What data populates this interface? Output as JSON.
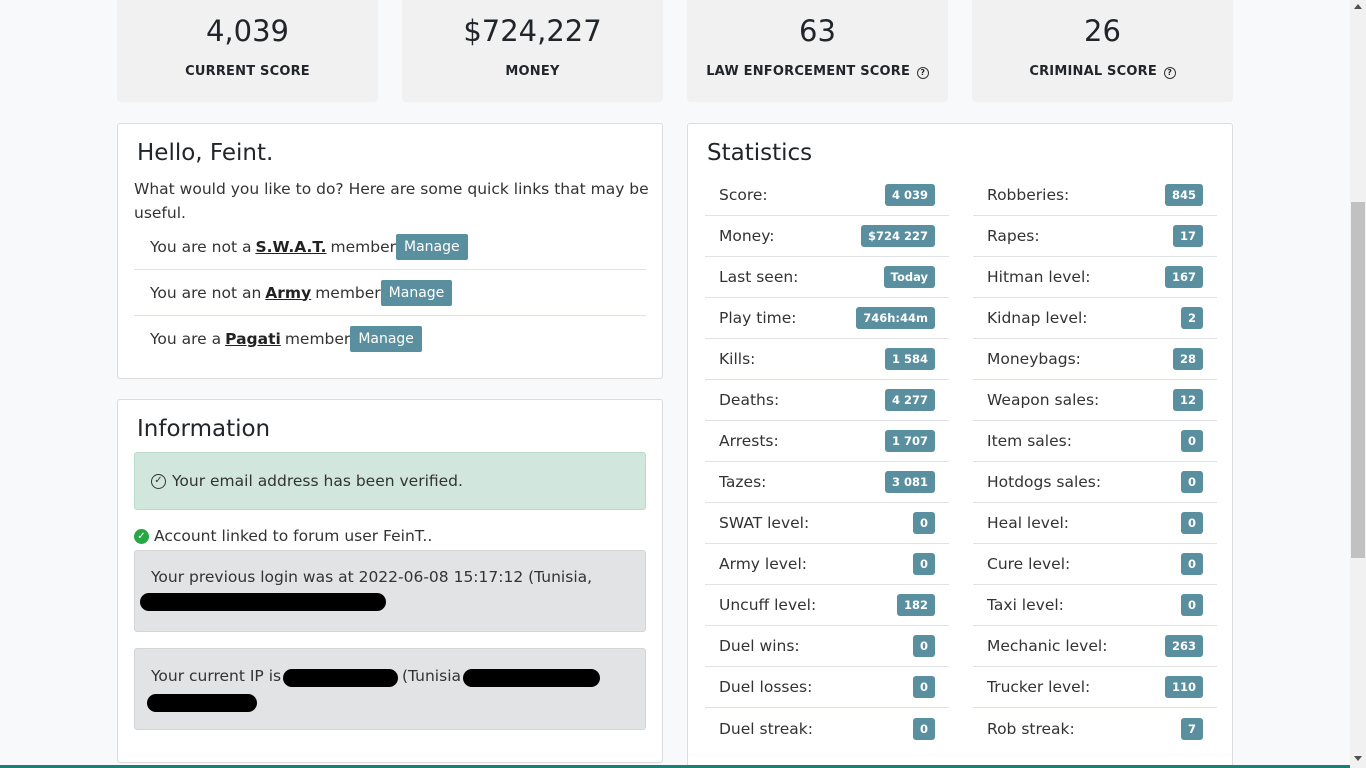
{
  "top_stats": [
    {
      "value": "4,039",
      "label": "CURRENT SCORE",
      "help": false
    },
    {
      "value": "$724,227",
      "label": "MONEY",
      "help": false
    },
    {
      "value": "63",
      "label": "LAW ENFORCEMENT SCORE",
      "help": true
    },
    {
      "value": "26",
      "label": "CRIMINAL SCORE",
      "help": true
    }
  ],
  "hello": {
    "title": "Hello, Feint.",
    "intro": "What would you like to do? Here are some quick links that may be useful.",
    "memberships": [
      {
        "prefix": "You are not a",
        "group": "S.W.A.T.",
        "suffix": "member",
        "button": "Manage"
      },
      {
        "prefix": "You are not an",
        "group": "Army",
        "suffix": "member",
        "button": "Manage"
      },
      {
        "prefix": "You are a",
        "group": "Pagati",
        "suffix": "member",
        "button": "Manage"
      }
    ]
  },
  "information": {
    "title": "Information",
    "email_verified": "Your email address has been verified.",
    "forum_linked": "Account linked to forum user FeinT..",
    "previous_login": "Your previous login was at 2022-06-08 15:17:12 (Tunisia,",
    "current_ip_prefix": "Your current IP is",
    "current_ip_country": "(Tunisia"
  },
  "statistics": {
    "title": "Statistics",
    "left": [
      {
        "label": "Score:",
        "value": "4 039"
      },
      {
        "label": "Money:",
        "value": "$724 227"
      },
      {
        "label": "Last seen:",
        "value": "Today"
      },
      {
        "label": "Play time:",
        "value": "746h:44m"
      },
      {
        "label": "Kills:",
        "value": "1 584"
      },
      {
        "label": "Deaths:",
        "value": "4 277"
      },
      {
        "label": "Arrests:",
        "value": "1 707"
      },
      {
        "label": "Tazes:",
        "value": "3 081"
      },
      {
        "label": "SWAT level:",
        "value": "0"
      },
      {
        "label": "Army level:",
        "value": "0"
      },
      {
        "label": "Uncuff level:",
        "value": "182"
      },
      {
        "label": "Duel wins:",
        "value": "0"
      },
      {
        "label": "Duel losses:",
        "value": "0"
      },
      {
        "label": "Duel streak:",
        "value": "0"
      }
    ],
    "right": [
      {
        "label": "Robberies:",
        "value": "845"
      },
      {
        "label": "Rapes:",
        "value": "17"
      },
      {
        "label": "Hitman level:",
        "value": "167"
      },
      {
        "label": "Kidnap level:",
        "value": "2"
      },
      {
        "label": "Moneybags:",
        "value": "28"
      },
      {
        "label": "Weapon sales:",
        "value": "12"
      },
      {
        "label": "Item sales:",
        "value": "0"
      },
      {
        "label": "Hotdogs sales:",
        "value": "0"
      },
      {
        "label": "Heal level:",
        "value": "0"
      },
      {
        "label": "Cure level:",
        "value": "0"
      },
      {
        "label": "Taxi level:",
        "value": "0"
      },
      {
        "label": "Mechanic level:",
        "value": "263"
      },
      {
        "label": "Trucker level:",
        "value": "110"
      },
      {
        "label": "Rob streak:",
        "value": "7"
      }
    ]
  },
  "colors": {
    "badge": "#5a8fa0",
    "success_bg": "#d1e7dd",
    "info_bg": "#e2e3e5",
    "accent": "#17a2b8"
  }
}
